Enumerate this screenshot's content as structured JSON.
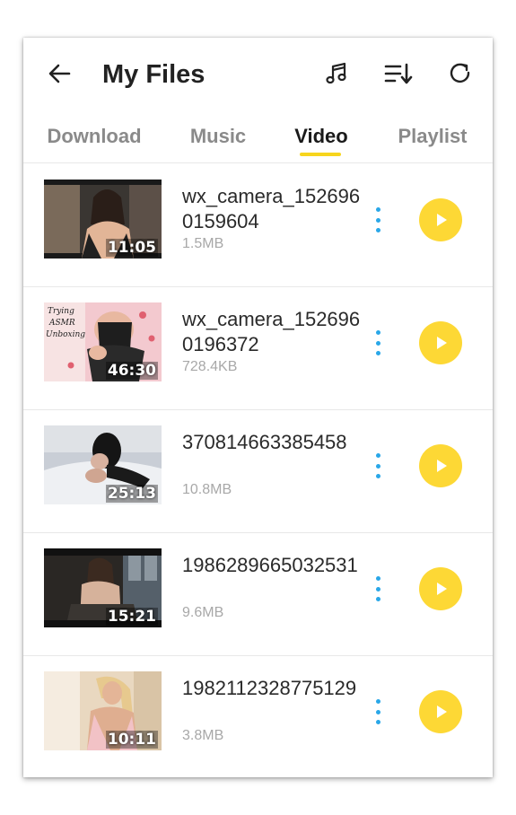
{
  "header": {
    "title": "My Files",
    "icons": [
      "back-arrow-icon",
      "music-note-icon",
      "sort-list-icon",
      "refresh-icon"
    ]
  },
  "tabs": [
    {
      "label": "Download",
      "active": false
    },
    {
      "label": "Music",
      "active": false
    },
    {
      "label": "Video",
      "active": true
    },
    {
      "label": "Playlist",
      "active": false
    }
  ],
  "colors": {
    "accent": "#f7d51d",
    "play_button": "#fdd835",
    "more_dots": "#29a7e8",
    "inactive_tab": "#8a8a8a"
  },
  "videos": [
    {
      "name": "wx_camera_1526960159604",
      "size": "1.5MB",
      "duration": "11:05"
    },
    {
      "name": "wx_camera_1526960196372",
      "size": "728.4KB",
      "duration": "46:30",
      "thumb_text": "Trying ASMR Unboxing"
    },
    {
      "name": "370814663385458",
      "size": "10.8MB",
      "duration": "25:13"
    },
    {
      "name": "1986289665032531",
      "size": "9.6MB",
      "duration": "15:21"
    },
    {
      "name": "1982112328775129",
      "size": "3.8MB",
      "duration": "10:11"
    }
  ]
}
